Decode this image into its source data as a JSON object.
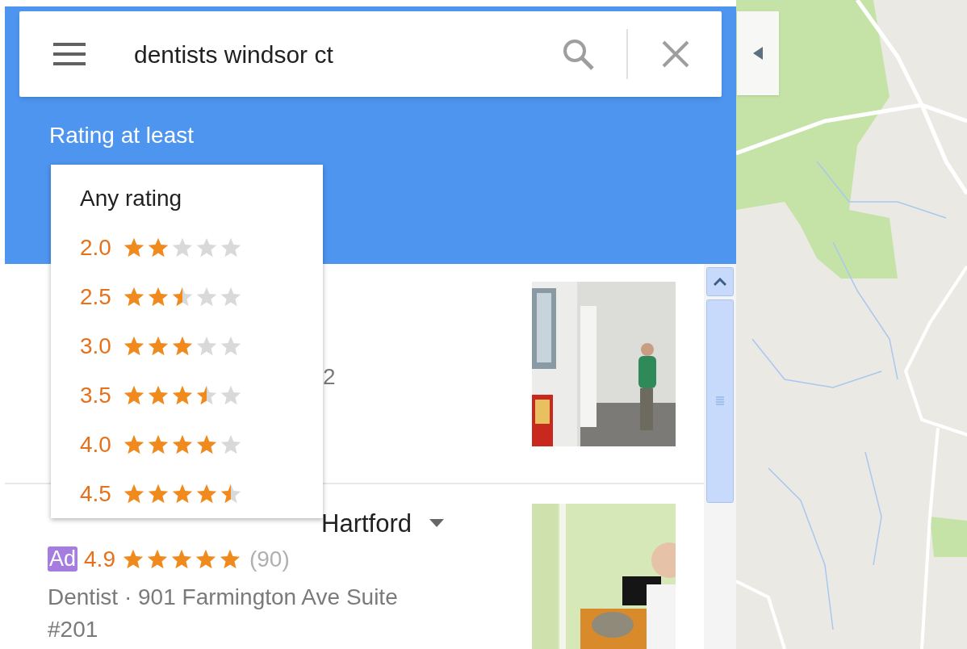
{
  "search": {
    "value": "dentists windsor ct"
  },
  "filter": {
    "label": "Rating at least",
    "options": [
      {
        "kind": "text",
        "label": "Any rating",
        "selected": false
      },
      {
        "kind": "stars",
        "label": "2.0",
        "stars": 2,
        "selected": false
      },
      {
        "kind": "stars",
        "label": "2.5",
        "stars": 2.5,
        "selected": false
      },
      {
        "kind": "stars",
        "label": "3.0",
        "stars": 3,
        "selected": false
      },
      {
        "kind": "stars",
        "label": "3.5",
        "stars": 3.5,
        "selected": false
      },
      {
        "kind": "stars",
        "label": "4.0",
        "stars": 4,
        "selected": false
      },
      {
        "kind": "stars",
        "label": "4.5",
        "stars": 4.5,
        "selected": false
      }
    ]
  },
  "results": [
    {
      "visible_fragment": "2"
    },
    {
      "title": "Hartford",
      "badge": "Ad",
      "rating": "4.9",
      "stars": 5,
      "reviews": "(90)",
      "details": "Dentist · 901 Farmington Ave Suite #201"
    }
  ]
}
